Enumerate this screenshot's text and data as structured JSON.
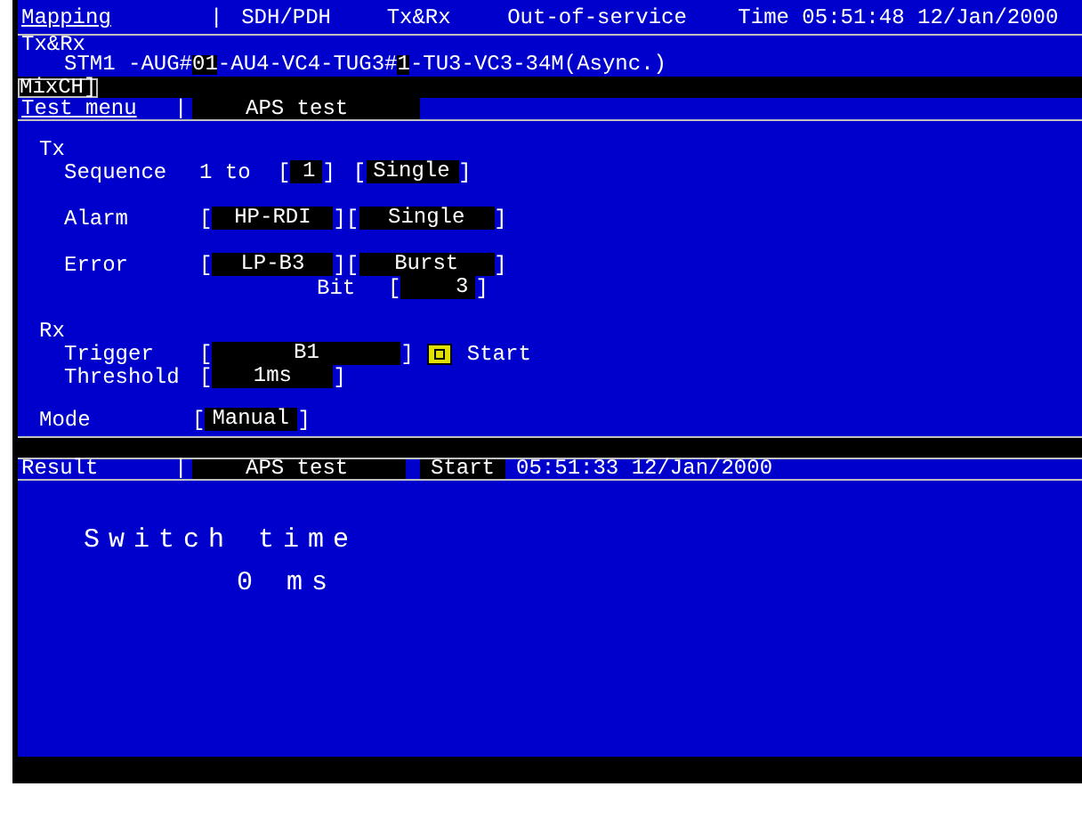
{
  "header": {
    "items": [
      {
        "text": "Mapping",
        "kind": "menu"
      },
      {
        "text": "|",
        "kind": "sep"
      },
      {
        "text": "SDH/PDH",
        "kind": "info"
      },
      {
        "text": "Tx&Rx",
        "kind": "info"
      },
      {
        "text": "Out-of-service",
        "kind": "info"
      },
      {
        "text": "Time 05:51:48 12/Jan/2000",
        "kind": "info"
      }
    ]
  },
  "path": {
    "title": "Tx&Rx",
    "segments": [
      {
        "text": "STM1 -AUG#",
        "selected": false
      },
      {
        "text": "01",
        "selected": true
      },
      {
        "text": "-AU4-VC4-TUG3#",
        "selected": false
      },
      {
        "text": "1",
        "selected": true
      },
      {
        "text": "-TU3-VC3-34M(Async.)",
        "selected": false
      }
    ]
  },
  "mix": {
    "label": "MixCH]"
  },
  "test_menu": {
    "label": "Test menu",
    "sep": "|",
    "name": "APS test"
  },
  "tx": {
    "title": "Tx",
    "sequence": {
      "label": "Sequence",
      "prefix": "1 to",
      "value": {
        "open": "[",
        "text": "1",
        "close": "]"
      },
      "mode": {
        "open": "[",
        "text": "Single",
        "close": "]"
      }
    },
    "alarm": {
      "label": "Alarm",
      "type": {
        "open": "[",
        "text": "HP-RDI",
        "close": "]"
      },
      "mode": {
        "open": "[",
        "text": "Single",
        "close": "]"
      }
    },
    "error": {
      "label": "Error",
      "type": {
        "open": "[",
        "text": "LP-B3",
        "close": "]"
      },
      "mode": {
        "open": "[",
        "text": "Burst",
        "close": "]"
      },
      "bit_label": "Bit",
      "bit": {
        "open": "[",
        "text": "3",
        "close": "]"
      }
    }
  },
  "rx": {
    "title": "Rx",
    "trigger": {
      "label": "Trigger",
      "value": {
        "open": "[",
        "text": "B1",
        "close": "]"
      },
      "start": {
        "checked": true,
        "label": "Start"
      }
    },
    "threshold": {
      "label": "Threshold",
      "value": {
        "open": "[",
        "text": "1ms",
        "close": "]"
      }
    }
  },
  "mode": {
    "label": "Mode",
    "value": {
      "open": "[",
      "text": "Manual",
      "close": "]"
    }
  },
  "result": {
    "label": "Result",
    "sep": "|",
    "name": "APS test",
    "status": "Start",
    "time": "05:51:33 12/Jan/2000",
    "metric": "Switch time",
    "value": "0 ms"
  }
}
